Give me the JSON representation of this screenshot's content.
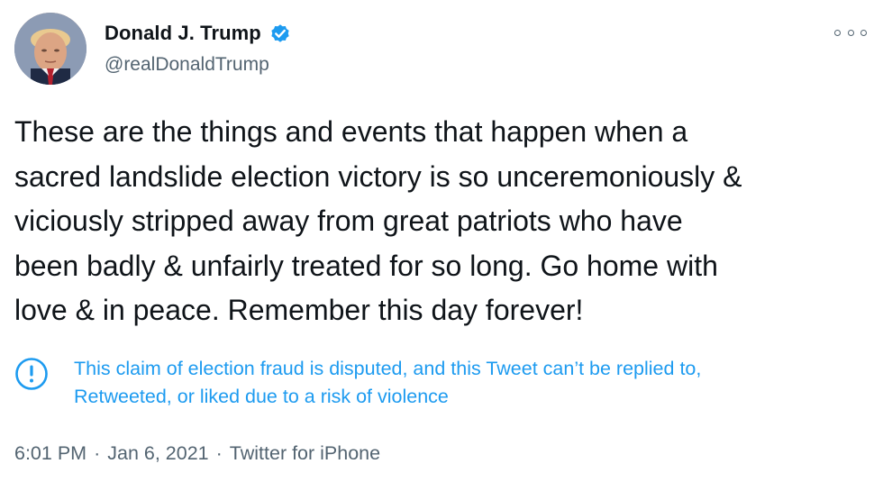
{
  "user": {
    "display_name": "Donald J. Trump",
    "handle": "@realDonaldTrump",
    "verified": true,
    "avatar_icon": "user-avatar"
  },
  "tweet": {
    "text": "These are the things and events that happen when a\nsacred landslide election victory is so unceremoniously &\nviciously stripped away from great patriots who have\nbeen badly & unfairly treated for so long. Go home with\nlove & in peace. Remember this day forever!"
  },
  "notice": {
    "line1": "This claim of election fraud is disputed, and this Tweet can’t be replied to,",
    "line2": "Retweeted, or liked due to a risk of violence",
    "icon": "exclamation-circle-icon"
  },
  "meta": {
    "time": "6:01 PM",
    "separator": "·",
    "date": "Jan 6, 2021",
    "source": "Twitter for iPhone"
  },
  "colors": {
    "accent": "#1d9bf0",
    "text": "#0f1419",
    "secondary": "#536471"
  },
  "icons": {
    "more": "more-options-icon",
    "verified": "verified-badge-icon"
  }
}
